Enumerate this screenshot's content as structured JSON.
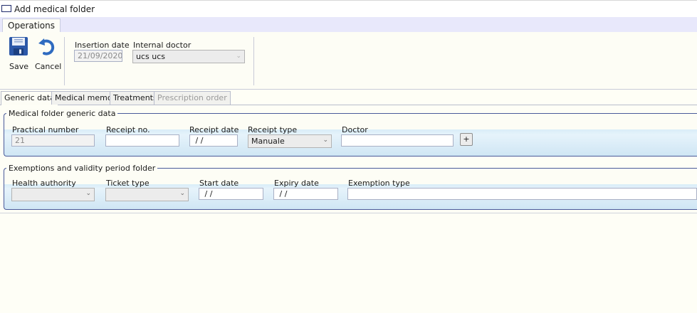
{
  "window": {
    "title": "Add medical folder"
  },
  "ribbon": {
    "tab": "Operations",
    "save_label": "Save",
    "cancel_label": "Cancel",
    "insertion_date_label": "Insertion date",
    "insertion_date_value": "21/09/2020",
    "internal_doctor_label": "Internal doctor",
    "internal_doctor_value": "ucs ucs"
  },
  "tabs": [
    "Generic data",
    "Medical memo",
    "Treatments",
    "Prescription order"
  ],
  "generic_group": {
    "title": "Medical folder generic data",
    "practical_number_label": "Practical number",
    "practical_number_value": "21",
    "receipt_no_label": "Receipt no.",
    "receipt_no_value": "",
    "receipt_date_label": "Receipt date",
    "receipt_date_value": " / /",
    "receipt_type_label": "Receipt type",
    "receipt_type_value": "Manuale",
    "doctor_label": "Doctor",
    "doctor_value": "",
    "add_button": "+"
  },
  "exemptions_group": {
    "title": "Exemptions and validity period folder",
    "health_authority_label": "Health authority",
    "ticket_type_label": "Ticket type",
    "start_date_label": "Start date",
    "start_date_value": " / /",
    "expiry_date_label": "Expiry date",
    "expiry_date_value": " / /",
    "exemption_type_label": "Exemption type",
    "exemption_type_value": ""
  },
  "colors": {
    "accent": "#1f5fb0",
    "group_border": "#4a5a9a",
    "ribbon_bg": "#e8e8fb"
  },
  "icons": {
    "save": "floppy-disk-icon",
    "cancel": "undo-arrow-icon",
    "dropdown": "chevron-down-icon"
  }
}
